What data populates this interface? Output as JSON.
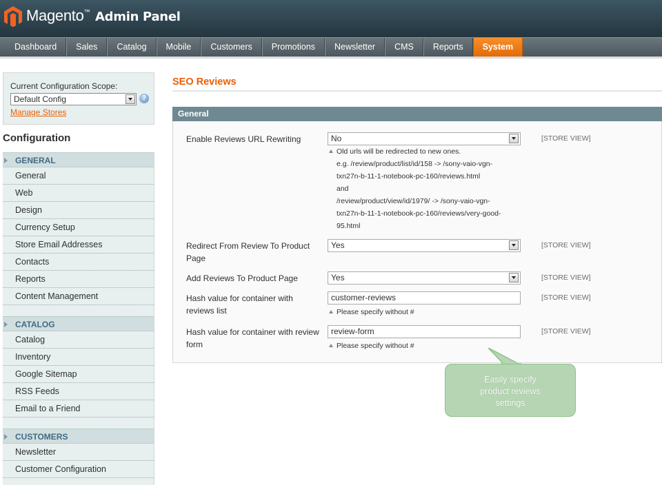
{
  "header": {
    "brand": "Magento",
    "trademark": "™",
    "subtitle": "Admin Panel",
    "logo_icon": "magento-logo-icon"
  },
  "nav": {
    "items": [
      {
        "label": "Dashboard"
      },
      {
        "label": "Sales"
      },
      {
        "label": "Catalog"
      },
      {
        "label": "Mobile"
      },
      {
        "label": "Customers"
      },
      {
        "label": "Promotions"
      },
      {
        "label": "Newsletter"
      },
      {
        "label": "CMS"
      },
      {
        "label": "Reports"
      },
      {
        "label": "System",
        "active": true
      }
    ],
    "active_color": "#f08a1f"
  },
  "sidebar": {
    "scope_label": "Current Configuration Scope:",
    "scope_value": "Default Config",
    "manage_stores": "Manage Stores",
    "help_icon": "help-icon",
    "config_title": "Configuration",
    "groups": [
      {
        "title": "GENERAL",
        "items": [
          "General",
          "Web",
          "Design",
          "Currency Setup",
          "Store Email Addresses",
          "Contacts",
          "Reports",
          "Content Management"
        ]
      },
      {
        "title": "CATALOG",
        "items": [
          "Catalog",
          "Inventory",
          "Google Sitemap",
          "RSS Feeds",
          "Email to a Friend"
        ]
      },
      {
        "title": "CUSTOMERS",
        "items": [
          "Newsletter",
          "Customer Configuration"
        ]
      }
    ]
  },
  "main": {
    "page_title": "SEO Reviews",
    "fieldset_title": "General",
    "rows": [
      {
        "label": "Enable Reviews URL Rewriting",
        "value": "No",
        "type": "select",
        "scope": "[STORE VIEW]",
        "note": [
          "Old urls will be redirected to new ones.",
          "e.g. /review/product/list/id/158 -> /sony-vaio-vgn-",
          "txn27n-b-11-1-notebook-pc-160/reviews.html",
          "and",
          "/review/product/view/id/1979/ -> /sony-vaio-vgn-",
          "txn27n-b-11-1-notebook-pc-160/reviews/very-good-",
          "95.html"
        ]
      },
      {
        "label": "Redirect From Review To Product Page",
        "value": "Yes",
        "type": "select",
        "scope": "[STORE VIEW]"
      },
      {
        "label": "Add Reviews To Product Page",
        "value": "Yes",
        "type": "select",
        "scope": "[STORE VIEW]"
      },
      {
        "label": "Hash value for container with reviews list",
        "value": "customer-reviews",
        "type": "text",
        "scope": "[STORE VIEW]",
        "note": [
          "Please specify without #"
        ]
      },
      {
        "label": "Hash value for container with review form",
        "value": "review-form",
        "type": "text",
        "scope": "[STORE VIEW]",
        "note": [
          "Please specify without #"
        ]
      }
    ],
    "title_color": "#eb5e00",
    "fieldset_head_color": "#6f8992"
  },
  "callout": {
    "text": [
      "Easily specify",
      "product reviews",
      "settings"
    ],
    "color": "#b6d6b3"
  }
}
